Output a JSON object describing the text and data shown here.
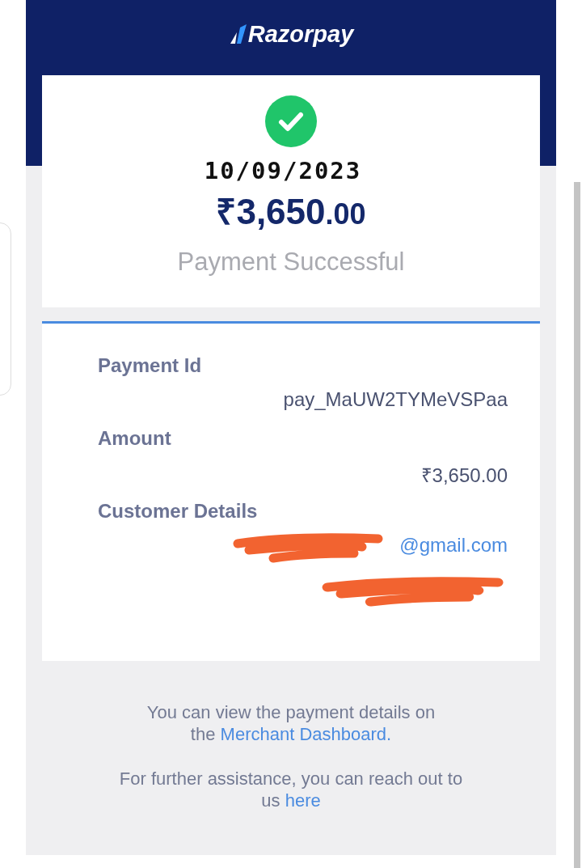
{
  "header": {
    "brand": "Razorpay"
  },
  "summary": {
    "date": "10/09/2023",
    "amount_major": "₹3,650",
    "amount_minor": ".00",
    "message": "Payment Successful"
  },
  "details": [
    {
      "label": "Payment Id",
      "values": [
        {
          "text": "pay_MaUW2TYMeVSPaa",
          "kind": "plain"
        }
      ]
    },
    {
      "label": "Amount",
      "values": [
        {
          "text": "₹3,650.00",
          "kind": "plain"
        }
      ]
    },
    {
      "label": "Customer Details",
      "values": [
        {
          "text": "@gmail.com",
          "kind": "redacted_email"
        },
        {
          "kind": "redacted"
        }
      ]
    }
  ],
  "footer": [
    {
      "lines": [
        "You can view the payment details on",
        "the"
      ],
      "link": "Merchant Dashboard."
    },
    {
      "lines": [
        "For further assistance, you can reach out to",
        "us"
      ],
      "link": "here"
    }
  ]
}
